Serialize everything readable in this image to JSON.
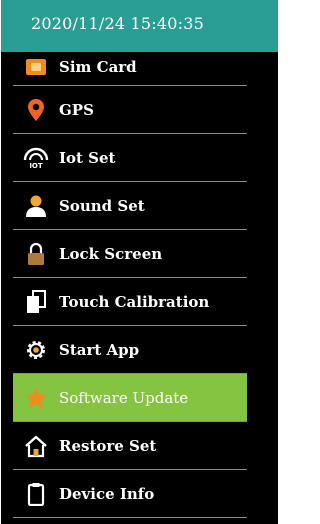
{
  "status_bar": {
    "datetime": "2020/11/24 15:40:35"
  },
  "colors": {
    "header": "#2a9d95",
    "active": "#84c441",
    "accent": "#f28b1e",
    "gps": "#f0642a"
  },
  "menu": {
    "items": [
      {
        "label": "Sim Card",
        "icon": "sim-card-icon"
      },
      {
        "label": "GPS",
        "icon": "location-pin-icon"
      },
      {
        "label": "Iot Set",
        "icon": "iot-icon"
      },
      {
        "label": "Sound Set",
        "icon": "user-icon"
      },
      {
        "label": "Lock Screen",
        "icon": "lock-icon"
      },
      {
        "label": "Touch Calibration",
        "icon": "copy-icon"
      },
      {
        "label": "Start App",
        "icon": "gear-icon"
      },
      {
        "label": "Software Update",
        "icon": "star-icon",
        "selected": true
      },
      {
        "label": "Restore Set",
        "icon": "home-icon"
      },
      {
        "label": "Device Info",
        "icon": "clipboard-icon"
      }
    ]
  }
}
